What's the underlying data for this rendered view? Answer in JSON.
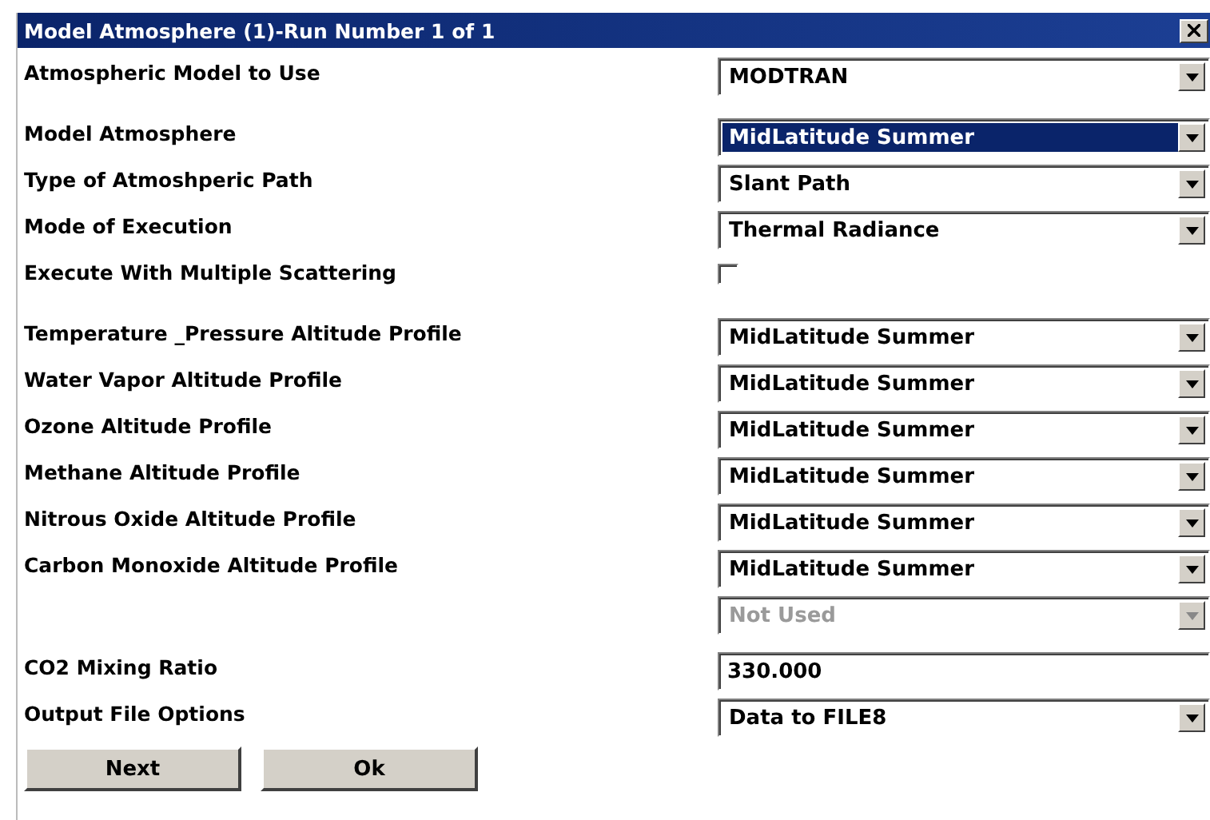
{
  "window": {
    "title": "Model Atmosphere (1)-Run Number  1 of  1"
  },
  "sections": [
    {
      "rows": [
        {
          "label": "Atmospheric Model to Use",
          "kind": "select",
          "value": "MODTRAN",
          "focused": false,
          "disabled": false
        }
      ]
    },
    {
      "rows": [
        {
          "label": "Model Atmosphere",
          "kind": "select",
          "value": "MidLatitude Summer",
          "focused": true,
          "disabled": false
        },
        {
          "label": "Type of Atmoshperic Path",
          "kind": "select",
          "value": "Slant Path",
          "focused": false,
          "disabled": false
        },
        {
          "label": "Mode of Execution",
          "kind": "select",
          "value": "Thermal Radiance",
          "focused": false,
          "disabled": false
        },
        {
          "label": "Execute With Multiple Scattering",
          "kind": "checkbox",
          "checked": false
        }
      ]
    },
    {
      "rows": [
        {
          "label": "Temperature _Pressure Altitude Profile",
          "kind": "select",
          "value": "MidLatitude Summer",
          "focused": false,
          "disabled": false
        },
        {
          "label": "Water Vapor Altitude Profile",
          "kind": "select",
          "value": "MidLatitude Summer",
          "focused": false,
          "disabled": false
        },
        {
          "label": "Ozone Altitude Profile",
          "kind": "select",
          "value": "MidLatitude Summer",
          "focused": false,
          "disabled": false
        },
        {
          "label": "Methane Altitude Profile",
          "kind": "select",
          "value": "MidLatitude Summer",
          "focused": false,
          "disabled": false
        },
        {
          "label": "Nitrous Oxide Altitude Profile",
          "kind": "select",
          "value": "MidLatitude Summer",
          "focused": false,
          "disabled": false
        },
        {
          "label": "Carbon Monoxide Altitude Profile",
          "kind": "select",
          "value": "MidLatitude Summer",
          "focused": false,
          "disabled": false
        },
        {
          "kind": "select",
          "value": "Not Used",
          "focused": false,
          "disabled": true
        }
      ]
    },
    {
      "rows": [
        {
          "label": "CO2 Mixing Ratio",
          "kind": "text",
          "value": "330.000"
        },
        {
          "label": "Output File Options",
          "kind": "select",
          "value": "Data to FILE8",
          "focused": false,
          "disabled": false
        }
      ]
    }
  ],
  "buttons": [
    "Next",
    "Ok"
  ]
}
